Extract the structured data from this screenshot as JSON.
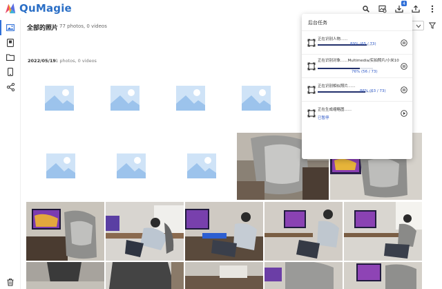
{
  "app": {
    "name": "QuMagie",
    "colors": {
      "brand": "#2b6fc6",
      "accent": "#2f6fd8",
      "progress": "#22306b"
    }
  },
  "header": {
    "icons": [
      "search-icon",
      "image-search-icon",
      "download-task-icon",
      "upload-icon",
      "more-icon"
    ],
    "task_badge": "4"
  },
  "sidebar": {
    "items": [
      "photos-icon",
      "album-icon",
      "folder-icon",
      "phone-icon",
      "share-icon"
    ],
    "bottom": "trash-icon"
  },
  "main": {
    "title": "全部的照片",
    "subtitle": "77 photos, 0 videos",
    "group_date": "2022/05/19",
    "group_count": "21 photos, 0 videos"
  },
  "tasks_popup": {
    "title": "后台任务",
    "tasks": [
      {
        "name": "正在识别人物......",
        "progress": 0.89,
        "percent_text": "89% (65 / 73)",
        "action": "pause"
      },
      {
        "name": "正在识别对象......Multimedia/实拍照片/小米104/芭蕉处理完毕...",
        "progress": 0.76,
        "percent_text": "76% (56 / 73)",
        "action": "pause"
      },
      {
        "name": "正在识别相似照片......",
        "progress": 0.86,
        "percent_text": "86% (63 / 73)",
        "action": "pause"
      },
      {
        "name": "正在生成缩略图......",
        "status": "已暂停",
        "action": "play"
      }
    ]
  }
}
